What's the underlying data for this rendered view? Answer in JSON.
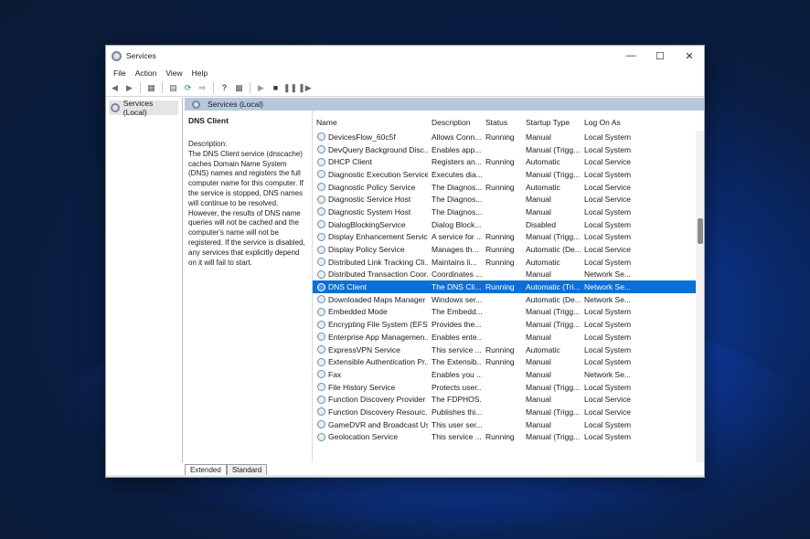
{
  "window": {
    "title": "Services"
  },
  "menu": [
    "File",
    "Action",
    "View",
    "Help"
  ],
  "tree": {
    "item": "Services (Local)"
  },
  "header": {
    "title": "Services (Local)"
  },
  "description": {
    "service_name": "DNS Client",
    "label": "Description:",
    "text": "The DNS Client service (dnscache) caches Domain Name System (DNS) names and registers the full computer name for this computer. If the service is stopped, DNS names will continue to be resolved. However, the results of DNS name queries will not be cached and the computer's name will not be registered. If the service is disabled, any services that explicitly depend on it will fail to start."
  },
  "columns": [
    "Name",
    "Description",
    "Status",
    "Startup Type",
    "Log On As"
  ],
  "rows": [
    [
      "DevicesFlow_60c5f",
      "Allows Conn...",
      "Running",
      "Manual",
      "Local System"
    ],
    [
      "DevQuery Background Disc...",
      "Enables app...",
      "",
      "Manual (Trigg...",
      "Local System"
    ],
    [
      "DHCP Client",
      "Registers an...",
      "Running",
      "Automatic",
      "Local Service"
    ],
    [
      "Diagnostic Execution Service",
      "Executes dia...",
      "",
      "Manual (Trigg...",
      "Local System"
    ],
    [
      "Diagnostic Policy Service",
      "The Diagnos...",
      "Running",
      "Automatic",
      "Local Service"
    ],
    [
      "Diagnostic Service Host",
      "The Diagnos...",
      "",
      "Manual",
      "Local Service"
    ],
    [
      "Diagnostic System Host",
      "The Diagnos...",
      "",
      "Manual",
      "Local System"
    ],
    [
      "DialogBlockingService",
      "Dialog Block...",
      "",
      "Disabled",
      "Local System"
    ],
    [
      "Display Enhancement Service",
      "A service for ...",
      "Running",
      "Manual (Trigg...",
      "Local System"
    ],
    [
      "Display Policy Service",
      "Manages th...",
      "Running",
      "Automatic (De...",
      "Local Service"
    ],
    [
      "Distributed Link Tracking Cli...",
      "Maintains li...",
      "Running",
      "Automatic",
      "Local System"
    ],
    [
      "Distributed Transaction Coor...",
      "Coordinates ...",
      "",
      "Manual",
      "Network Se..."
    ],
    [
      "DNS Client",
      "The DNS Cli...",
      "Running",
      "Automatic (Tri...",
      "Network Se..."
    ],
    [
      "Downloaded Maps Manager",
      "Windows ser...",
      "",
      "Automatic (De...",
      "Network Se..."
    ],
    [
      "Embedded Mode",
      "The Embedd...",
      "",
      "Manual (Trigg...",
      "Local System"
    ],
    [
      "Encrypting File System (EFS)",
      "Provides the...",
      "",
      "Manual (Trigg...",
      "Local System"
    ],
    [
      "Enterprise App Managemen...",
      "Enables ente...",
      "",
      "Manual",
      "Local System"
    ],
    [
      "ExpressVPN Service",
      "This service ...",
      "Running",
      "Automatic",
      "Local System"
    ],
    [
      "Extensible Authentication Pr...",
      "The Extensib...",
      "Running",
      "Manual",
      "Local System"
    ],
    [
      "Fax",
      "Enables you ...",
      "",
      "Manual",
      "Network Se..."
    ],
    [
      "File History Service",
      "Protects user...",
      "",
      "Manual (Trigg...",
      "Local System"
    ],
    [
      "Function Discovery Provider ...",
      "The FDPHOS...",
      "",
      "Manual",
      "Local Service"
    ],
    [
      "Function Discovery Resourc...",
      "Publishes thi...",
      "",
      "Manual (Trigg...",
      "Local Service"
    ],
    [
      "GameDVR and Broadcast Us...",
      "This user ser...",
      "",
      "Manual",
      "Local System"
    ],
    [
      "Geolocation Service",
      "This service ...",
      "Running",
      "Manual (Trigg...",
      "Local System"
    ]
  ],
  "selected_row": 12,
  "tabs": [
    "Extended",
    "Standard"
  ]
}
